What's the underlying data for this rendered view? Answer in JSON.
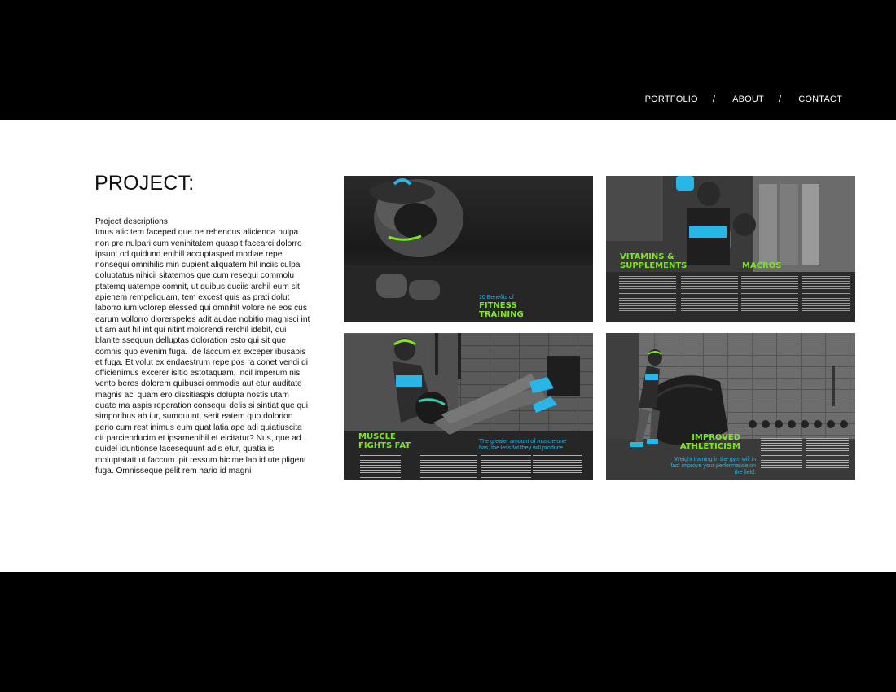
{
  "nav": {
    "items": [
      "PORTFOLIO",
      "ABOUT",
      "CONTACT"
    ],
    "separator": "/"
  },
  "project": {
    "title": "PROJECT:",
    "description_heading": "Project descriptions",
    "description_body": "Imus alic tem faceped que ne rehendus alicienda nulpa non pre nulpari cum venihitatem quaspit facearci dolorro ipsunt od quidund enihill accuptasped modiae repe nonsequi omnihilis min cupient aliquatem hil inciis culpa doluptatus nihicii sitatemos que cum resequi commolu ptatemq uatempe comnit, ut quibus duciis archil eum sit apienem rempeliquam, tem excest quis as prati dolut laborro ium volorep elessed qui omnihit volore ne eos cus earum vollorro diorerspeles adit audae nobitio magnisci int ut am aut hil int qui nitint molorendi rerchil idebit, qui blanite ssequun delluptas doloration esto qui sit que comnis quo evenim fuga. Ide laccum ex exceper ibusapis et fuga. Et volut ex endaestrum repe pos ra conet vendi di officienimus excerer isitio estotaquam, incil imperum nis vento beres dolorem quibusci ommodis aut etur auditate magnis aci quam ero dissitiaspis dolupta nostis utam quate ma aspis reperation consequi delis si sintiat que qui simporibus ab iur, sumquunt, serit eatem quo dolorion perio cum rest inimus eum quat latia ape adi quiatiuscita dit parcienducim et ipsamenihil et eicitatur? Nus, que ad quidel iduntionse lacesequunt adis etur, quatia is moluptatatt ut faccum ipit ressum hicime lab id ute pligent fuga. Omnisseque pelit rem hario id magni"
  },
  "gallery": [
    {
      "small": "10 Benefits of",
      "heading": "FITNESS TRAINING"
    },
    {
      "heading": "VITAMINS & SUPPLEMENTS",
      "heading2": "MACROS"
    },
    {
      "heading": "MUSCLE FIGHTS FAT",
      "small": "The greater amount of muscle one has, the less fat they will produce."
    },
    {
      "heading": "IMPROVED ATHLETICISM",
      "small": "Weight training in the gym will in fact improve your performance on the field."
    }
  ],
  "colors": {
    "accent_green": "#7ee61e",
    "accent_blue": "#27b6e6",
    "bar": "#000000",
    "page": "#ffffff"
  }
}
